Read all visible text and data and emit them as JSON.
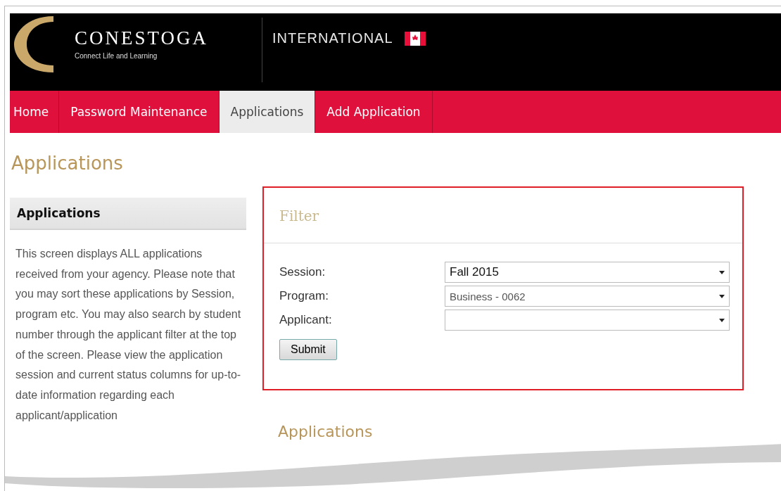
{
  "header": {
    "brand": "CONESTOGA",
    "tagline": "Connect Life and Learning",
    "section": "INTERNATIONAL"
  },
  "nav": [
    {
      "label": "Home",
      "selected": false
    },
    {
      "label": "Password Maintenance",
      "selected": false
    },
    {
      "label": "Applications",
      "selected": true
    },
    {
      "label": "Add Application",
      "selected": false
    }
  ],
  "page_title": "Applications",
  "sidebar": {
    "title": "Applications",
    "text": "This screen displays ALL applications received from your agency. Please note that you may sort these applications by Session, program etc. You may also search by student number through the applicant filter at the top of the screen. Please view the application session and current status columns for up-to-date information regarding each applicant/application"
  },
  "filter": {
    "title": "Filter",
    "fields": [
      {
        "label": "Session:",
        "value": "Fall 2015"
      },
      {
        "label": "Program:",
        "value": "Business - 0062"
      },
      {
        "label": "Applicant:"
      }
    ],
    "submit": "Submit"
  },
  "results_title": "Applications"
}
